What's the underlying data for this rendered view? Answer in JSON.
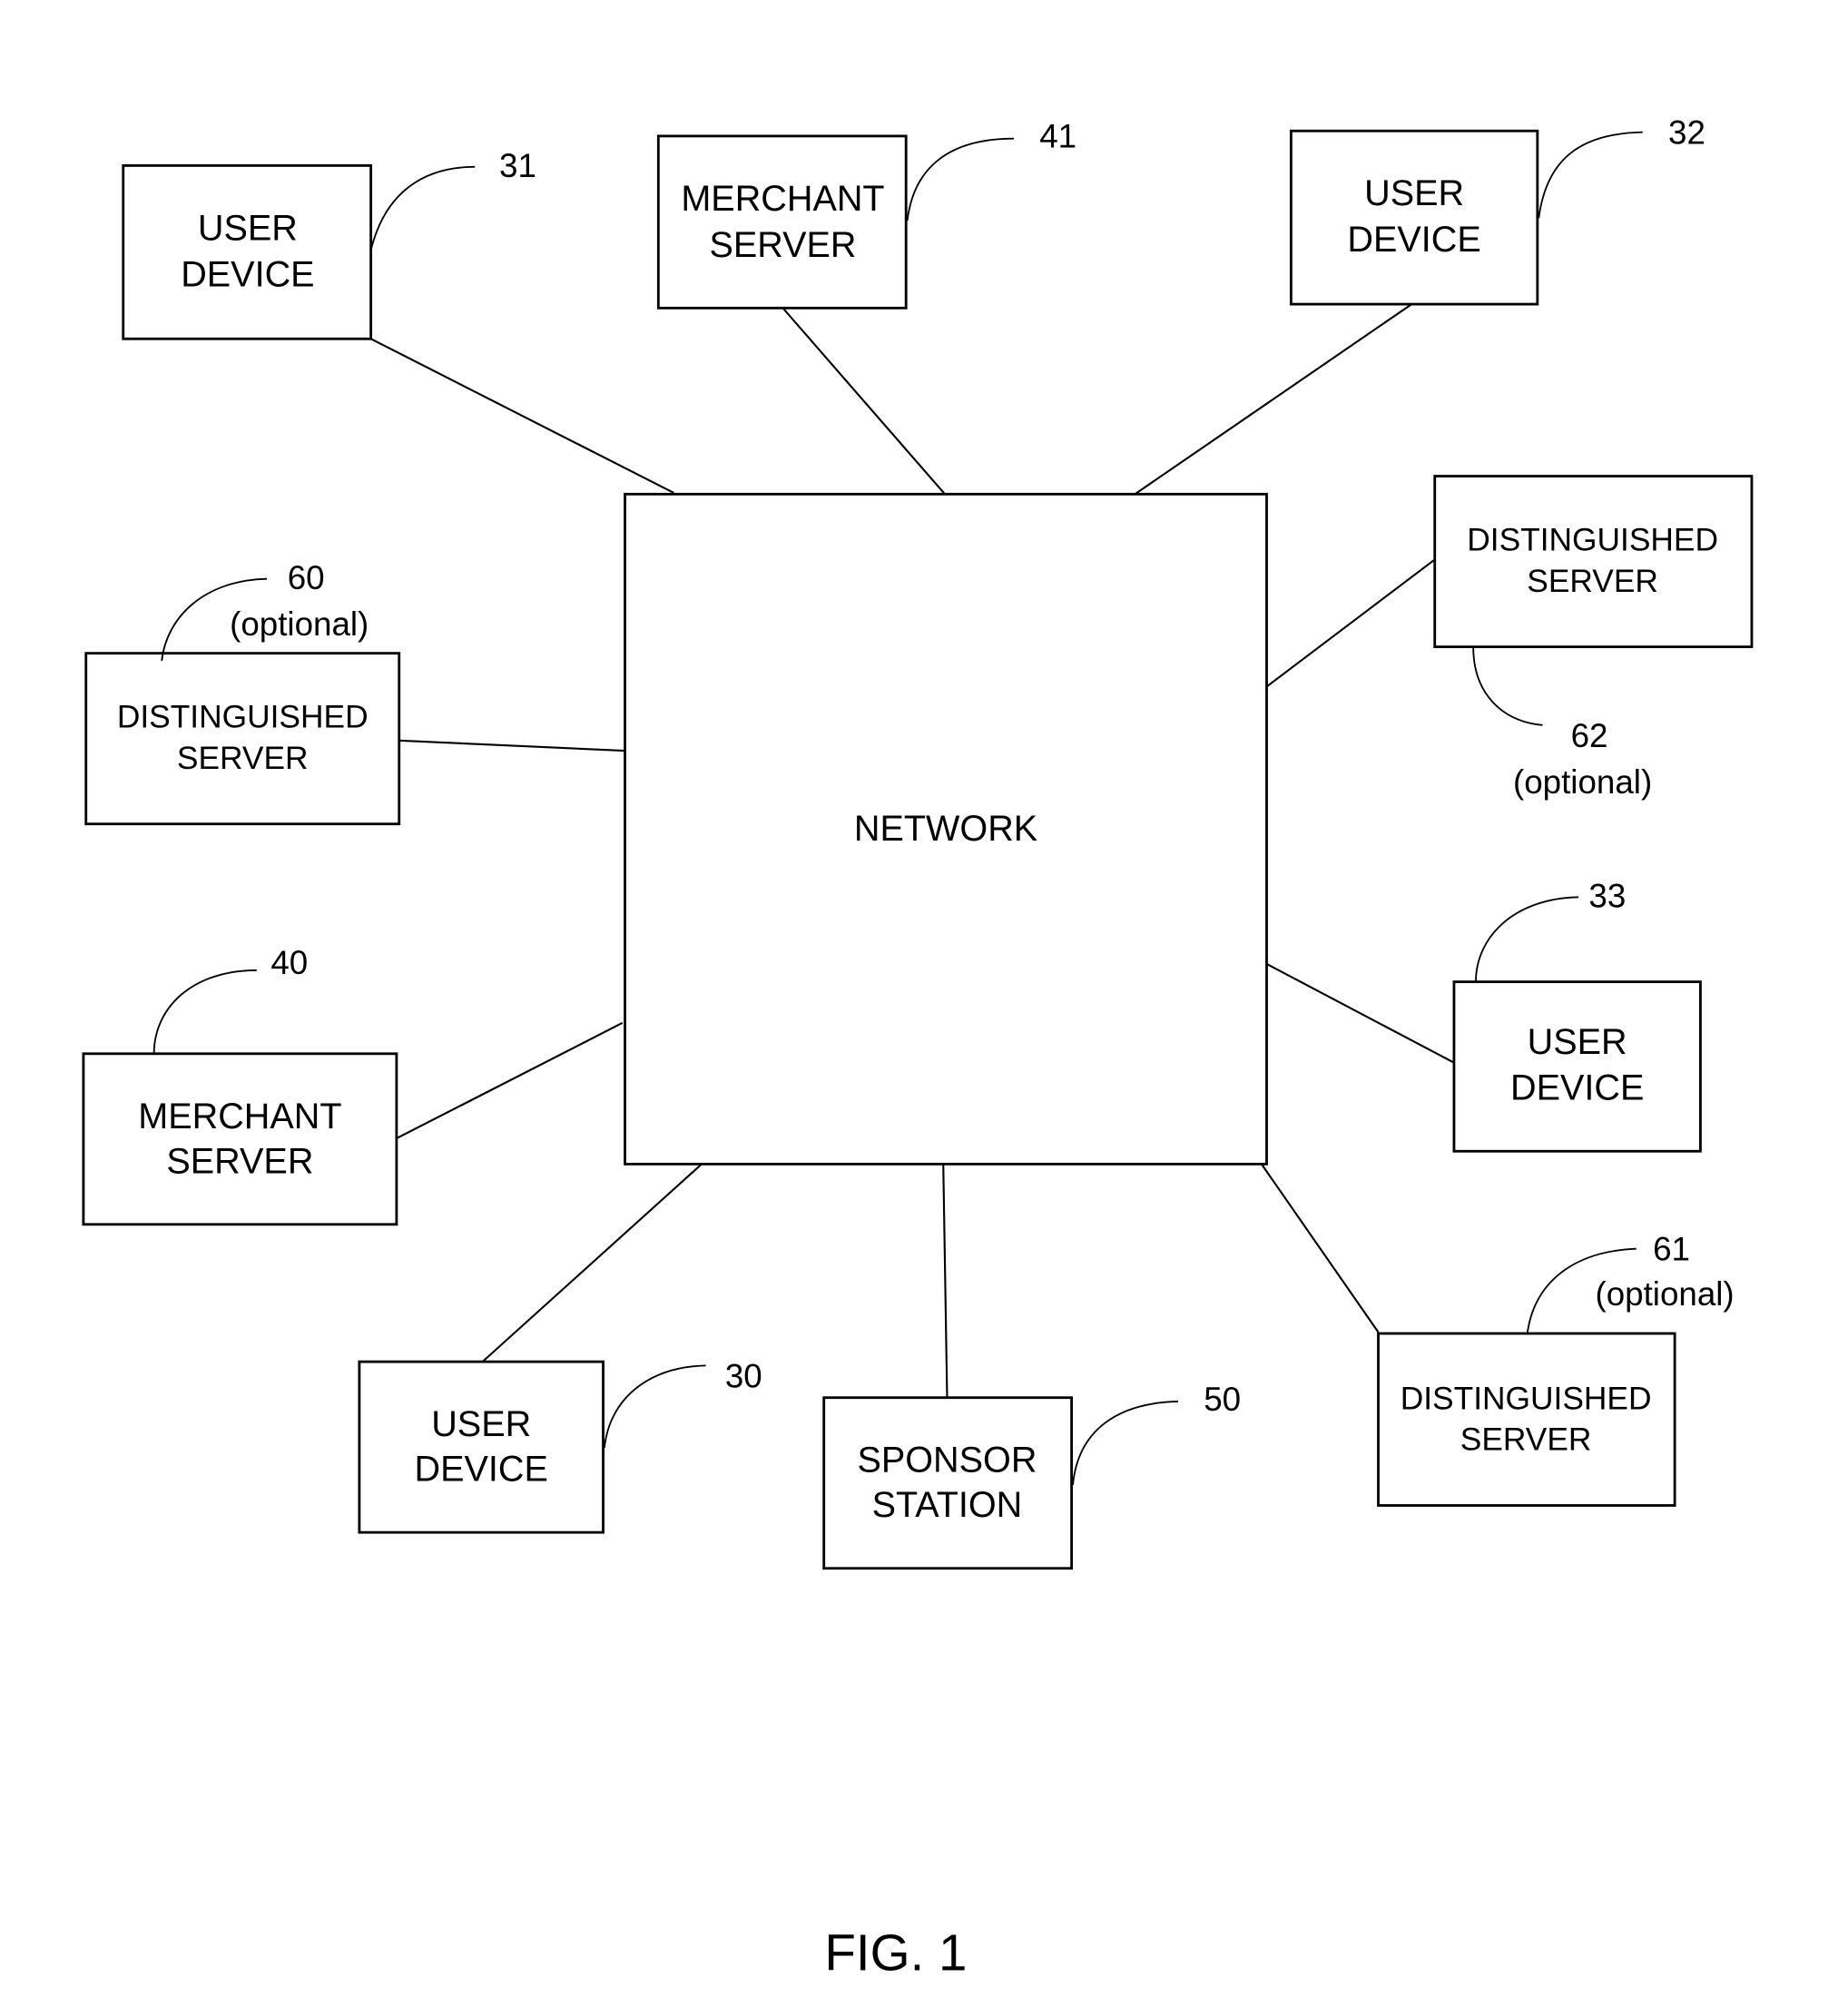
{
  "figure": {
    "caption": "FIG. 1",
    "center_node": {
      "id": "network",
      "label": "NETWORK"
    },
    "nodes": [
      {
        "id": "user-device-31",
        "lines": [
          "USER",
          "DEVICE"
        ],
        "ref": "31",
        "note": ""
      },
      {
        "id": "merchant-server-41",
        "lines": [
          "MERCHANT",
          "SERVER"
        ],
        "ref": "41",
        "note": ""
      },
      {
        "id": "user-device-32",
        "lines": [
          "USER",
          "DEVICE"
        ],
        "ref": "32",
        "note": ""
      },
      {
        "id": "distinguished-server-62",
        "lines": [
          "DISTINGUISHED",
          "SERVER"
        ],
        "ref": "62",
        "note": "(optional)"
      },
      {
        "id": "distinguished-server-60",
        "lines": [
          "DISTINGUISHED",
          "SERVER"
        ],
        "ref": "60",
        "note": "(optional)"
      },
      {
        "id": "user-device-33",
        "lines": [
          "USER",
          "DEVICE"
        ],
        "ref": "33",
        "note": ""
      },
      {
        "id": "merchant-server-40",
        "lines": [
          "MERCHANT",
          "SERVER"
        ],
        "ref": "40",
        "note": ""
      },
      {
        "id": "distinguished-server-61",
        "lines": [
          "DISTINGUISHED",
          "SERVER"
        ],
        "ref": "61",
        "note": "(optional)"
      },
      {
        "id": "user-device-30",
        "lines": [
          "USER",
          "DEVICE"
        ],
        "ref": "30",
        "note": ""
      },
      {
        "id": "sponsor-station-50",
        "lines": [
          "SPONSOR",
          "STATION"
        ],
        "ref": "50",
        "note": ""
      }
    ],
    "edges": [
      {
        "from": "network",
        "to": "user-device-31"
      },
      {
        "from": "network",
        "to": "merchant-server-41"
      },
      {
        "from": "network",
        "to": "user-device-32"
      },
      {
        "from": "network",
        "to": "distinguished-server-62"
      },
      {
        "from": "network",
        "to": "distinguished-server-60"
      },
      {
        "from": "network",
        "to": "user-device-33"
      },
      {
        "from": "network",
        "to": "merchant-server-40"
      },
      {
        "from": "network",
        "to": "distinguished-server-61"
      },
      {
        "from": "network",
        "to": "user-device-30"
      },
      {
        "from": "network",
        "to": "sponsor-station-50"
      }
    ]
  }
}
